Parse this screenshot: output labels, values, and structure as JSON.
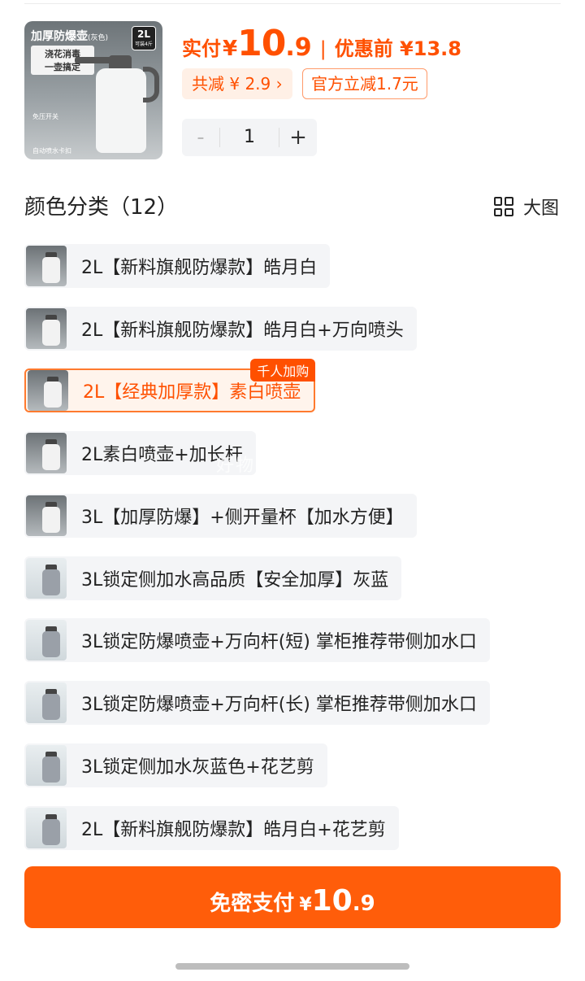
{
  "product": {
    "thumb_title": "加厚防爆壶",
    "thumb_title_sub": "(灰色)",
    "thumb_volume": "2L",
    "thumb_volume_sub": "可装4斤",
    "thumb_slogan_1": "浇花消毒",
    "thumb_slogan_2": "一壶搞定",
    "thumb_tag_1": "免压开关",
    "thumb_tag_2": "自动喷水卡扣"
  },
  "price": {
    "label": "实付",
    "currency": "¥",
    "integer": "10",
    "decimal": ".9",
    "separator": "|",
    "original": "优惠前 ¥13.8"
  },
  "discount": {
    "total": "共减 ¥ 2.9 ›",
    "coupon": "官方立减1.7元"
  },
  "quantity": {
    "minus": "-",
    "value": "1",
    "plus": "+"
  },
  "section": {
    "title": "颜色分类（12）",
    "big_view": "大图"
  },
  "options": [
    {
      "label": "2L【新料旗舰防爆款】皓月白"
    },
    {
      "label": "2L【新料旗舰防爆款】皓月白+万向喷头"
    },
    {
      "label": "2L【经典加厚款】素白喷壶",
      "badge": "千人加购",
      "selected": true
    },
    {
      "label": "2L素白喷壶+加长杆"
    },
    {
      "label": "3L【加厚防爆】+侧开量杯【加水方便】"
    },
    {
      "label": "3L锁定侧加水高品质【安全加厚】灰蓝"
    },
    {
      "label": "3L锁定防爆喷壶+万向杆(短) 掌柜推荐带侧加水口"
    },
    {
      "label": "3L锁定防爆喷壶+万向杆(长) 掌柜推荐带侧加水口"
    },
    {
      "label": "3L锁定侧加水灰蓝色+花艺剪"
    },
    {
      "label": "2L【新料旗舰防爆款】皓月白+花艺剪"
    }
  ],
  "watermark": "好物推荐呢",
  "pay": {
    "label": "免密支付",
    "currency": "¥",
    "integer": "10",
    "decimal": ".9"
  },
  "colors": {
    "accent": "#ff5000",
    "pay_button": "#ff5d0a",
    "option_bg": "#f4f5f7"
  }
}
